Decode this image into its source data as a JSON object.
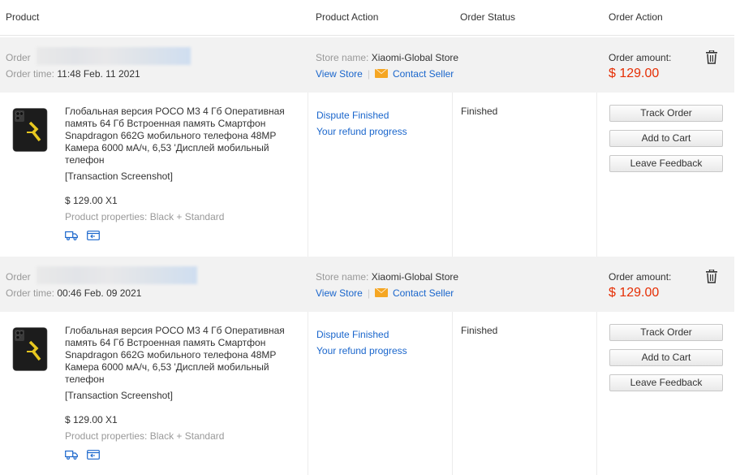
{
  "header": {
    "product": "Product",
    "product_action": "Product Action",
    "order_status": "Order Status",
    "order_action": "Order Action"
  },
  "orders": [
    {
      "order_label": "Order",
      "order_time_label": "Order time:",
      "order_time": "11:48 Feb. 11 2021",
      "store_label": "Store name:",
      "store_name": "Xiaomi-Global Store",
      "view_store": "View Store",
      "separator": "|",
      "contact_seller": "Contact Seller",
      "amount_label": "Order amount:",
      "amount": "$ 129.00",
      "product_title": "Глобальная версия POCO M3 4 Гб Оперативная память 64 Гб Встроенная память Смартфон Snapdragon 662G мобильного телефона 48MP Камера 6000 мА/ч, 6,53 'Дисплей мобильный телефон",
      "transaction_screenshot": "[Transaction Screenshot]",
      "price_qty": "$ 129.00 X1",
      "properties": "Product properties: Black + Standard",
      "dispute": "Dispute Finished",
      "refund": "Your refund progress",
      "status": "Finished",
      "buttons": {
        "track": "Track Order",
        "cart": "Add to Cart",
        "feedback": "Leave Feedback"
      }
    },
    {
      "order_label": "Order",
      "order_time_label": "Order time:",
      "order_time": "00:46 Feb. 09 2021",
      "store_label": "Store name:",
      "store_name": "Xiaomi-Global Store",
      "view_store": "View Store",
      "separator": "|",
      "contact_seller": "Contact Seller",
      "amount_label": "Order amount:",
      "amount": "$ 129.00",
      "product_title": "Глобальная версия POCO M3 4 Гб Оперативная память 64 Гб Встроенная память Смартфон Snapdragon 662G мобильного телефона 48MP Камера 6000 мА/ч, 6,53 'Дисплей мобильный телефон",
      "transaction_screenshot": "[Transaction Screenshot]",
      "price_qty": "$ 129.00 X1",
      "properties": "Product properties: Black + Standard",
      "dispute": "Dispute Finished",
      "refund": "Your refund progress",
      "status": "Finished",
      "buttons": {
        "track": "Track Order",
        "cart": "Add to Cart",
        "feedback": "Leave Feedback"
      }
    }
  ],
  "colors": {
    "link": "#1a66cc",
    "amount": "#e62e04",
    "order_header_bg": "#f2f2f2",
    "mail_icon": "#f5a623"
  },
  "icons": [
    "trash-icon",
    "mail-icon",
    "shipping-icon",
    "return-icon",
    "phone-thumbnail"
  ]
}
